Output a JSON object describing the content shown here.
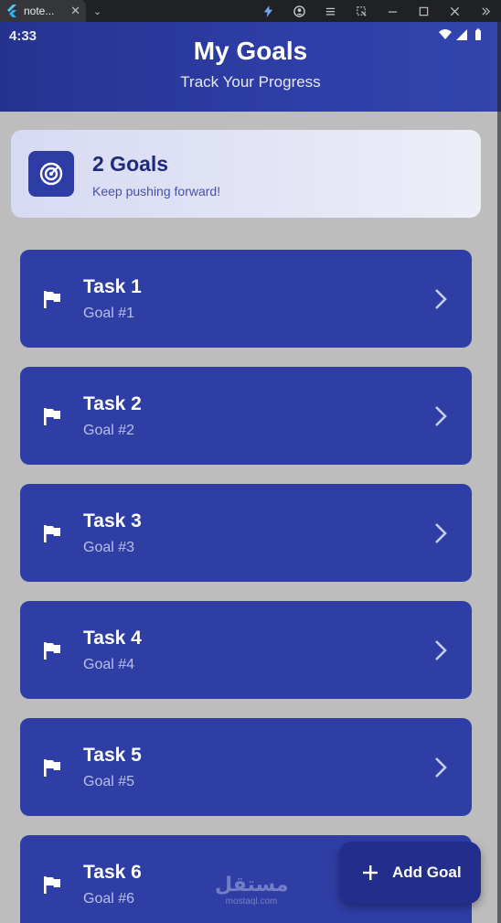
{
  "window": {
    "tab_title": "note...",
    "tab_close": "✕",
    "tab_menu": "⌄"
  },
  "status_bar": {
    "time": "4:33"
  },
  "header": {
    "title": "My Goals",
    "subtitle": "Track Your Progress"
  },
  "summary": {
    "count_label": "2 Goals",
    "message": "Keep pushing forward!"
  },
  "goals": [
    {
      "title": "Task 1",
      "subtitle": "Goal #1"
    },
    {
      "title": "Task 2",
      "subtitle": "Goal #2"
    },
    {
      "title": "Task 3",
      "subtitle": "Goal #3"
    },
    {
      "title": "Task 4",
      "subtitle": "Goal #4"
    },
    {
      "title": "Task 5",
      "subtitle": "Goal #5"
    },
    {
      "title": "Task 6",
      "subtitle": "Goal #6"
    }
  ],
  "fab": {
    "label": "Add Goal"
  },
  "watermark": {
    "arabic": "مستقل",
    "latin": "mostaql.com"
  },
  "icons": {
    "tab": "flutter-logo-icon",
    "goal": "flag-icon",
    "goal_action": "chevron-right-icon",
    "summary": "target-icon",
    "fab": "plus-icon"
  },
  "colors": {
    "primary": "#2f3ea5",
    "header": "#2a3899",
    "card_bg": "#e3e6f7",
    "page_bg": "#bdbdbd"
  }
}
